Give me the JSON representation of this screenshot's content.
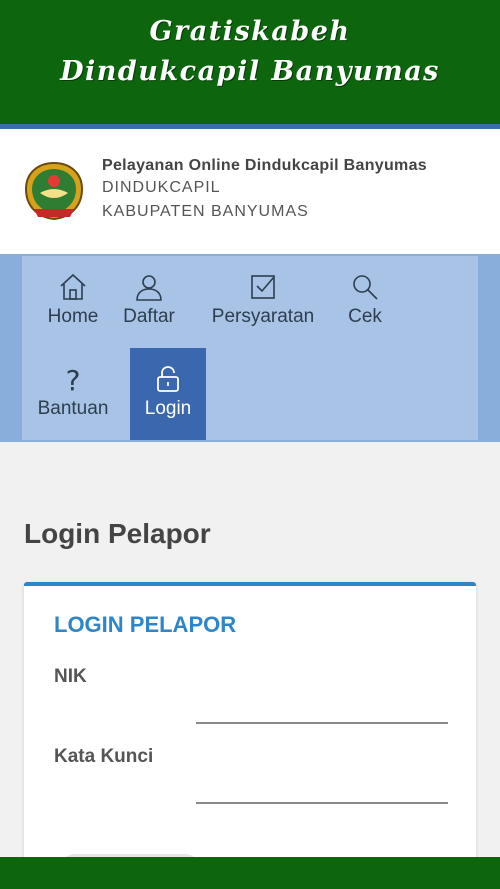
{
  "banner": {
    "line1": "Gratiskabeh",
    "line2": "Dindukcapil Banyumas"
  },
  "header": {
    "title": "Pelayanan Online Dindukcapil Banyumas",
    "subtitle1": "DINDUKCAPIL",
    "subtitle2": "KABUPATEN BANYUMAS",
    "logo_icon": "regency-emblem-icon"
  },
  "nav": {
    "items": [
      {
        "label": "Home",
        "icon": "home-icon"
      },
      {
        "label": "Daftar",
        "icon": "user-icon"
      },
      {
        "label": "Persyaratan",
        "icon": "checkbox-icon"
      },
      {
        "label": "Cek",
        "icon": "search-icon"
      },
      {
        "label": "Bantuan",
        "icon": "question-icon"
      },
      {
        "label": "Login",
        "icon": "lock-icon"
      }
    ],
    "active": "Login"
  },
  "page": {
    "title": "Login Pelapor"
  },
  "card": {
    "title": "LOGIN PELAPOR",
    "nik_label": "NIK",
    "nik_value": "",
    "password_label": "Kata Kunci",
    "password_value": ""
  },
  "colors": {
    "banner": "#0d660d",
    "nav": "#a9c3e6",
    "nav_active": "#3a67ad",
    "accent": "#2e86c8"
  }
}
